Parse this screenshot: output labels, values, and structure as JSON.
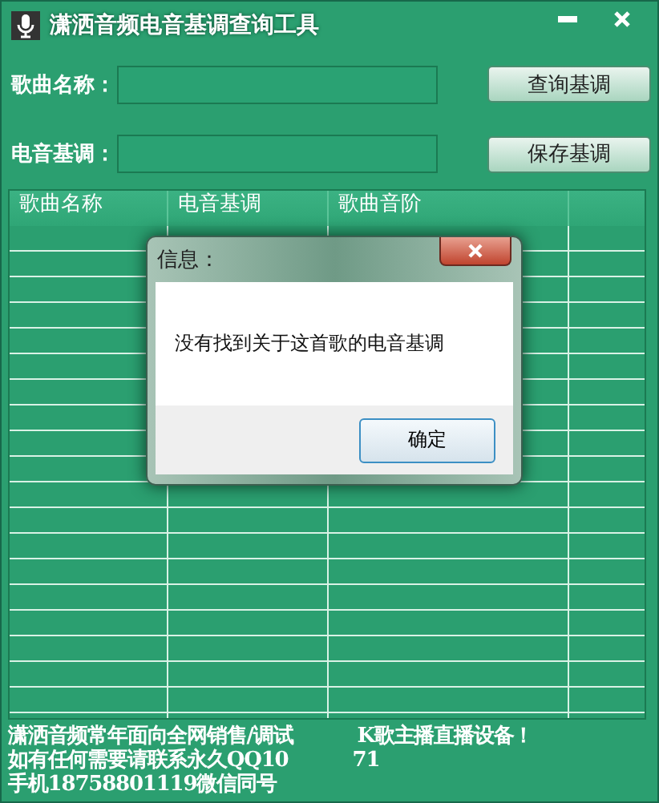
{
  "window": {
    "title": "潇洒音频电音基调查询工具"
  },
  "form": {
    "fields": [
      {
        "label": "歌曲名称：",
        "button": "查询基调"
      },
      {
        "label": "电音基调：",
        "button": "保存基调"
      }
    ]
  },
  "table": {
    "columns": [
      "歌曲名称",
      "电音基调",
      "歌曲音阶"
    ]
  },
  "footer": {
    "lines": [
      [
        "潇洒音频常年面向全网销售/调试",
        "K歌主播直播设备！"
      ],
      [
        "如有任何需要请联系永久QQ10",
        "71"
      ],
      [
        "手机18758801119微信同号"
      ]
    ]
  },
  "dialog": {
    "title": "信息：",
    "message": "没有找到关于这首歌的电音基调",
    "button": "确定"
  }
}
